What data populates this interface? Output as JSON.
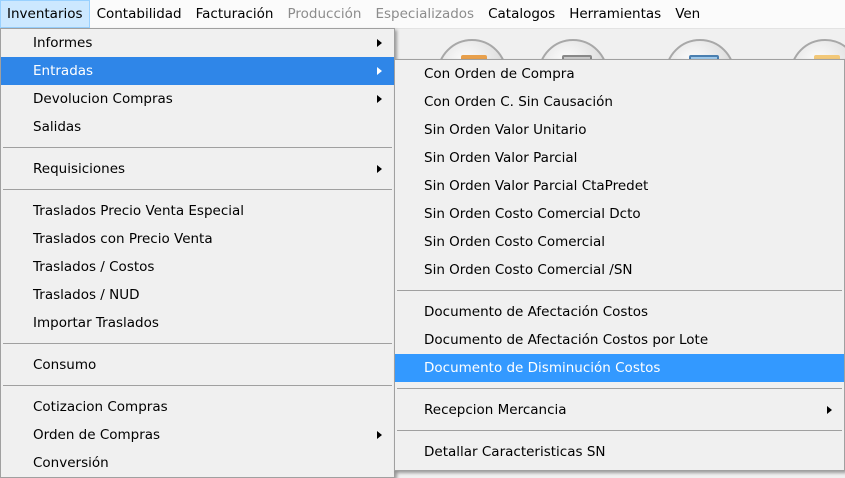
{
  "menubar": {
    "items": [
      {
        "label": "Inventarios"
      },
      {
        "label": "Contabilidad"
      },
      {
        "label": "Facturación"
      },
      {
        "label": "Producción"
      },
      {
        "label": "Especializados"
      },
      {
        "label": "Catalogos"
      },
      {
        "label": "Herramientas"
      },
      {
        "label": "Ven"
      }
    ]
  },
  "inventarios_menu": {
    "items": [
      {
        "label": "Informes"
      },
      {
        "label": "Entradas"
      },
      {
        "label": "Devolucion Compras"
      },
      {
        "label": "Salidas"
      },
      {
        "label": "Requisiciones"
      },
      {
        "label": "Traslados  Precio Venta Especial"
      },
      {
        "label": "Traslados con Precio Venta"
      },
      {
        "label": "Traslados  / Costos"
      },
      {
        "label": "Traslados / NUD"
      },
      {
        "label": "Importar Traslados"
      },
      {
        "label": "Consumo"
      },
      {
        "label": "Cotizacion Compras"
      },
      {
        "label": "Orden de Compras"
      },
      {
        "label": "Conversión"
      }
    ]
  },
  "entradas_submenu": {
    "items": [
      {
        "label": "Con Orden de Compra"
      },
      {
        "label": "Con Orden C. Sin Causación"
      },
      {
        "label": "Sin Orden Valor Unitario"
      },
      {
        "label": "Sin Orden Valor Parcial"
      },
      {
        "label": "Sin Orden Valor Parcial CtaPredet"
      },
      {
        "label": "Sin Orden Costo Comercial Dcto"
      },
      {
        "label": "Sin Orden Costo Comercial"
      },
      {
        "label": "Sin Orden Costo Comercial /SN"
      },
      {
        "label": "Documento de Afectación Costos"
      },
      {
        "label": "Documento de Afectación Costos por Lote"
      },
      {
        "label": "Documento de Disminución Costos"
      },
      {
        "label": "Recepcion Mercancia"
      },
      {
        "label": "Detallar Caracteristicas SN"
      }
    ]
  },
  "colors": {
    "highlight": "#3399ff",
    "menubar_active": "#cce8ff",
    "disabled_text": "#8c8c8c"
  }
}
